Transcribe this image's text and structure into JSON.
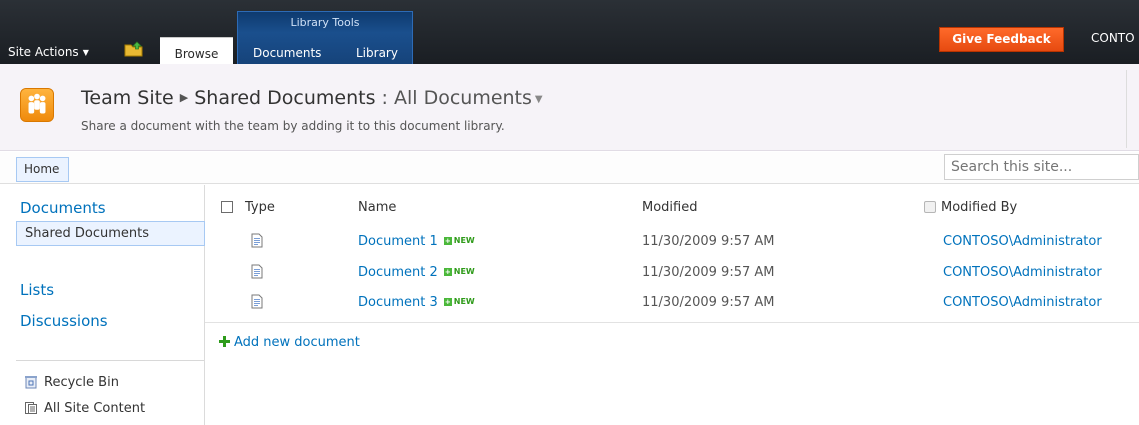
{
  "ribbon": {
    "site_actions": "Site Actions",
    "tab_browse": "Browse",
    "contextual_group": "Library Tools",
    "tab_documents": "Documents",
    "tab_library": "Library",
    "give_feedback": "Give Feedback",
    "user": "CONTO"
  },
  "title": {
    "site": "Team Site",
    "list": "Shared Documents",
    "separator": ":",
    "view": "All Documents",
    "description": "Share a document with the team by adding it to this document library."
  },
  "topnav": {
    "home": "Home",
    "search_placeholder": "Search this site..."
  },
  "leftnav": {
    "documents_heading": "Documents",
    "shared_documents": "Shared Documents",
    "lists_heading": "Lists",
    "discussions_heading": "Discussions",
    "recycle_bin": "Recycle Bin",
    "all_site_content": "All Site Content"
  },
  "list": {
    "columns": {
      "type": "Type",
      "name": "Name",
      "modified": "Modified",
      "modified_by": "Modified By"
    },
    "new_badge": "NEW",
    "rows": [
      {
        "name": "Document 1",
        "modified": "11/30/2009 9:57 AM",
        "modified_by": "CONTOSO\\Administrator"
      },
      {
        "name": "Document 2",
        "modified": "11/30/2009 9:57 AM",
        "modified_by": "CONTOSO\\Administrator"
      },
      {
        "name": "Document 3",
        "modified": "11/30/2009 9:57 AM",
        "modified_by": "CONTOSO\\Administrator"
      }
    ],
    "add_new": "Add new document"
  },
  "colors": {
    "link": "#0072bc",
    "ribbon_bg": "#1c2127",
    "feedback": "#f05a1a",
    "selected_bg": "#ebf3ff"
  }
}
